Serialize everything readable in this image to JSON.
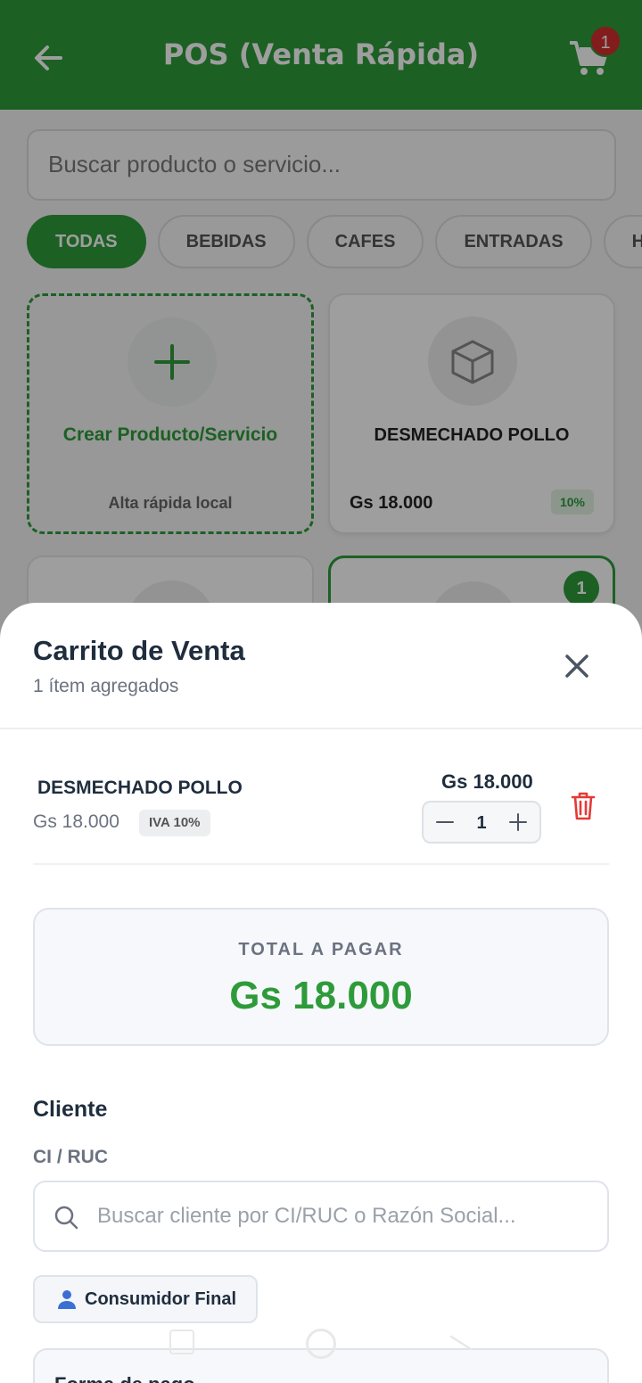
{
  "header": {
    "title": "POS (Venta Rápida)",
    "cart_count": "1",
    "color": "#2e9b3a"
  },
  "background": {
    "search_placeholder": "Buscar producto o servicio...",
    "categories": [
      "TODAS",
      "BEBIDAS",
      "CAFES",
      "ENTRADAS",
      "H"
    ],
    "active_category": "TODAS",
    "create_card": {
      "label": "Crear Producto/Servicio",
      "sub": "Alta rápida local"
    },
    "product_card": {
      "name": "DESMECHADO POLLO",
      "price": "Gs 18.000",
      "tax": "10%"
    },
    "selected_card_badge": "1"
  },
  "sheet": {
    "title": "Carrito de Venta",
    "subtitle": "1 ítem agregados",
    "items": [
      {
        "name": "DESMECHADO POLLO",
        "unit_price": "Gs 18.000",
        "tax": "IVA 10%",
        "total": "Gs 18.000",
        "qty": "1"
      }
    ],
    "total_label": "TOTAL A PAGAR",
    "total_value": "Gs 18.000",
    "client_section": "Cliente",
    "ci_label": "CI / RUC",
    "client_search_placeholder": "Buscar cliente por CI/RUC o Razón Social...",
    "consumer_button": "Consumidor Final",
    "payment_title": "Forma de pago"
  },
  "colors": {
    "accent": "#2e9b3a",
    "danger": "#d32f2f",
    "text": "#1f2d3d",
    "muted": "#6b7280"
  },
  "icons": [
    "back-arrow-icon",
    "cart-icon",
    "plus-icon",
    "box-icon",
    "close-icon",
    "minus-icon",
    "trash-icon",
    "search-icon",
    "user-icon"
  ]
}
